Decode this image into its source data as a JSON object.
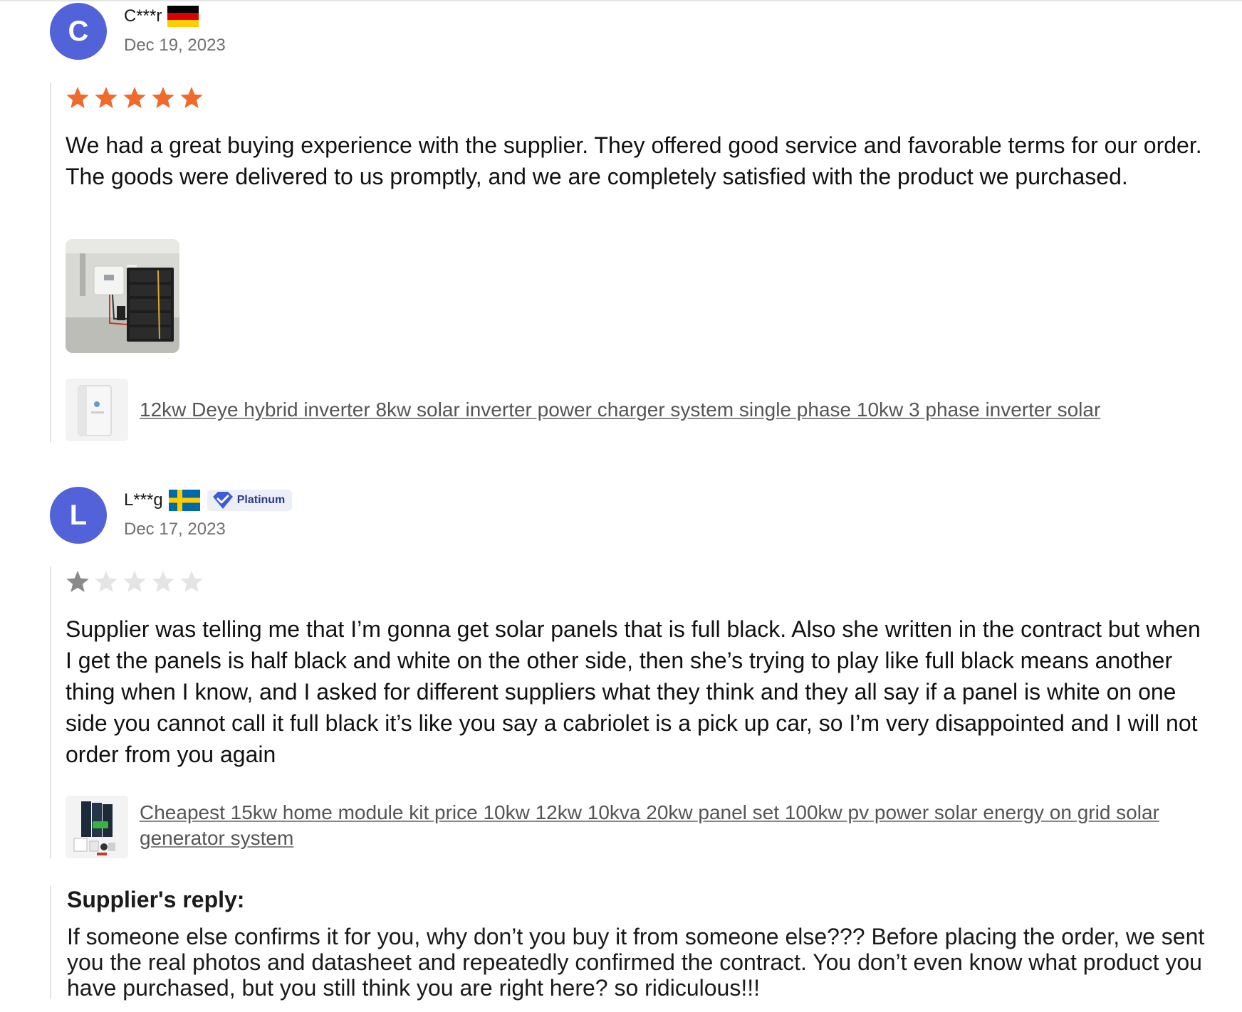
{
  "reviews": [
    {
      "avatar_letter": "C",
      "name": "C***r",
      "country": "Germany",
      "flag_icon": "germany-flag-icon",
      "date": "Dec 19, 2023",
      "rating": 5,
      "max_rating": 5,
      "star_color": "#f06a2c",
      "text": "We had a great buying experience with the supplier. They offered good service and favorable terms for our order. The goods were delivered to us promptly, and we are completely satisfied with the product we purchased.",
      "product_title": "12kw Deye hybrid inverter 8kw solar inverter power charger system single phase 10kw 3 phase inverter solar"
    },
    {
      "avatar_letter": "L",
      "name": "L***g",
      "country": "Sweden",
      "flag_icon": "sweden-flag-icon",
      "badge": "Platinum",
      "date": "Dec 17, 2023",
      "rating": 1,
      "max_rating": 5,
      "star_color": "#8a8a8a",
      "text": "Supplier was telling me that I’m gonna get solar panels that is full black. Also she written in the contract but when I get the panels is half black and white on the other side, then she’s trying to play like full black means another thing when I know, and I asked for different suppliers what they think and they all say if a panel is white on one side you cannot call it full black it’s like you say a cabriolet is a pick up car, so I’m very disappointed and I will not order from you again",
      "product_title": "Cheapest 15kw home module kit price 10kw 12kw 10kva 20kw panel set 100kw pv power solar energy on grid solar generator system",
      "reply_label": "Supplier's reply:",
      "reply_text": "If someone else confirms it for you, why don’t you buy it from someone else??? Before placing the order, we sent you the real photos and datasheet and repeatedly confirmed the contract. You don’t even know what product you have purchased, but you still think you are right here? so ridiculous!!!"
    }
  ],
  "colors": {
    "avatar": "#5262d8",
    "star_filled_orange": "#f06a2c",
    "star_filled_gray": "#8a8a8a",
    "star_empty": "#e4e4e4",
    "badge_blue": "#3b5bdb"
  }
}
